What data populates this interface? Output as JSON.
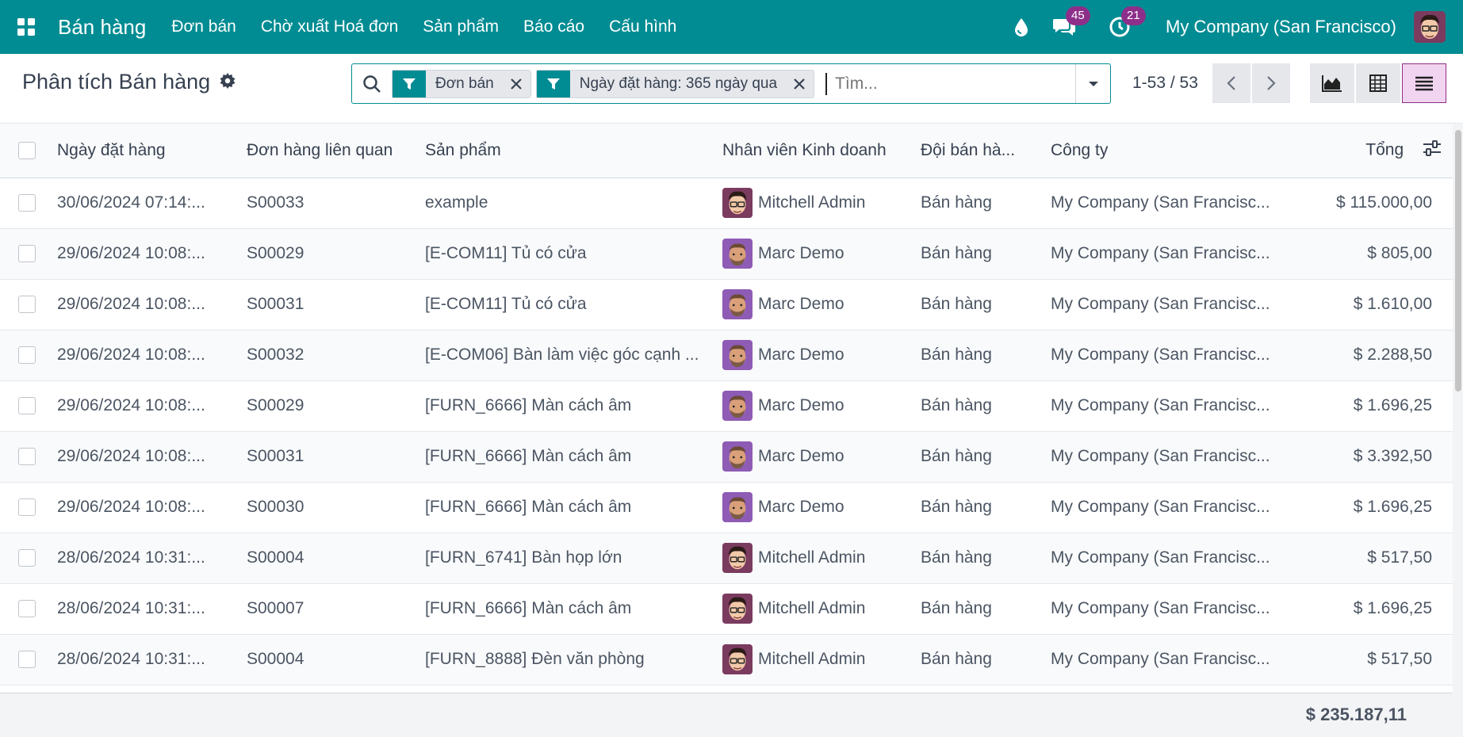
{
  "topbar": {
    "app_name": "Bán hàng",
    "menu": [
      "Đơn bán",
      "Chờ xuất Hoá đơn",
      "Sản phẩm",
      "Báo cáo",
      "Cấu hình"
    ],
    "messages_badge": "45",
    "activities_badge": "21",
    "company": "My Company (San Francisco)"
  },
  "control": {
    "title": "Phân tích Bán hàng",
    "facets": [
      "Đơn bán",
      "Ngày đặt hàng: 365 ngày qua"
    ],
    "search_placeholder": "Tìm...",
    "pager": "1-53 / 53"
  },
  "table": {
    "headers": [
      "Ngày đặt hàng",
      "Đơn hàng liên quan",
      "Sản phẩm",
      "Nhân viên Kinh doanh",
      "Đội bán hà...",
      "Công ty",
      "Tổng"
    ],
    "rows": [
      {
        "date": "30/06/2024 07:14:...",
        "order": "S00033",
        "product": "example",
        "salesperson": "Mitchell Admin",
        "avatar": "mitchell",
        "team": "Bán hàng",
        "company": "My Company (San Francisc...",
        "total": "$ 115.000,00"
      },
      {
        "date": "29/06/2024 10:08:...",
        "order": "S00029",
        "product": "[E-COM11] Tủ có cửa",
        "salesperson": "Marc Demo",
        "avatar": "marc",
        "team": "Bán hàng",
        "company": "My Company (San Francisc...",
        "total": "$ 805,00"
      },
      {
        "date": "29/06/2024 10:08:...",
        "order": "S00031",
        "product": "[E-COM11] Tủ có cửa",
        "salesperson": "Marc Demo",
        "avatar": "marc",
        "team": "Bán hàng",
        "company": "My Company (San Francisc...",
        "total": "$ 1.610,00"
      },
      {
        "date": "29/06/2024 10:08:...",
        "order": "S00032",
        "product": "[E-COM06] Bàn làm việc góc cạnh ...",
        "salesperson": "Marc Demo",
        "avatar": "marc",
        "team": "Bán hàng",
        "company": "My Company (San Francisc...",
        "total": "$ 2.288,50"
      },
      {
        "date": "29/06/2024 10:08:...",
        "order": "S00029",
        "product": "[FURN_6666] Màn cách âm",
        "salesperson": "Marc Demo",
        "avatar": "marc",
        "team": "Bán hàng",
        "company": "My Company (San Francisc...",
        "total": "$ 1.696,25"
      },
      {
        "date": "29/06/2024 10:08:...",
        "order": "S00031",
        "product": "[FURN_6666] Màn cách âm",
        "salesperson": "Marc Demo",
        "avatar": "marc",
        "team": "Bán hàng",
        "company": "My Company (San Francisc...",
        "total": "$ 3.392,50"
      },
      {
        "date": "29/06/2024 10:08:...",
        "order": "S00030",
        "product": "[FURN_6666] Màn cách âm",
        "salesperson": "Marc Demo",
        "avatar": "marc",
        "team": "Bán hàng",
        "company": "My Company (San Francisc...",
        "total": "$ 1.696,25"
      },
      {
        "date": "28/06/2024 10:31:...",
        "order": "S00004",
        "product": "[FURN_6741] Bàn họp lớn",
        "salesperson": "Mitchell Admin",
        "avatar": "mitchell",
        "team": "Bán hàng",
        "company": "My Company (San Francisc...",
        "total": "$ 517,50"
      },
      {
        "date": "28/06/2024 10:31:...",
        "order": "S00007",
        "product": "[FURN_6666] Màn cách âm",
        "salesperson": "Mitchell Admin",
        "avatar": "mitchell",
        "team": "Bán hàng",
        "company": "My Company (San Francisc...",
        "total": "$ 1.696,25"
      },
      {
        "date": "28/06/2024 10:31:...",
        "order": "S00004",
        "product": "[FURN_8888] Đèn văn phòng",
        "salesperson": "Mitchell Admin",
        "avatar": "mitchell",
        "team": "Bán hàng",
        "company": "My Company (San Francisc...",
        "total": "$ 517,50"
      }
    ],
    "grand_total": "$ 235.187,11"
  },
  "colors": {
    "brand": "#018c93",
    "accent": "#8d2f8a"
  }
}
